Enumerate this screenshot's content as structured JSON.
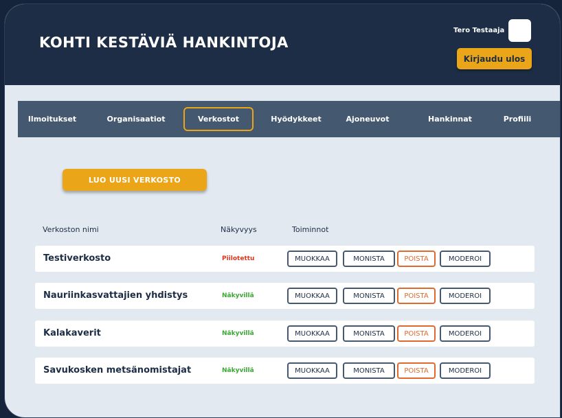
{
  "header": {
    "title": "KOHTI KESTÄVIÄ HANKINTOJA",
    "user_name": "Tero Testaaja",
    "logout_label": "Kirjaudu ulos"
  },
  "nav": {
    "items": [
      "Ilmoitukset",
      "Organisaatiot",
      "Verkostot",
      "Hyödykkeet",
      "Ajoneuvot",
      "Hankinnat",
      "Profiili"
    ],
    "active": "Verkostot"
  },
  "create_button_label": "LUO UUSI VERKOSTO",
  "table": {
    "columns": [
      "Verkoston nimi",
      "Näkyvyys",
      "Toiminnot"
    ],
    "action_labels": [
      "MUOKKAA",
      "MONISTA",
      "POISTA",
      "MODEROI"
    ],
    "rows": [
      {
        "name": "Testiverkosto",
        "visibility": "Piilotettu",
        "visibility_color": "#e0361c"
      },
      {
        "name": "Nauriinkasvattajien yhdistys",
        "visibility": "Näkyvillä",
        "visibility_color": "#3aa832"
      },
      {
        "name": "Kalakaverit",
        "visibility": "Näkyvillä",
        "visibility_color": "#3aa832"
      },
      {
        "name": "Savukosken metsänomistajat",
        "visibility": "Näkyvillä",
        "visibility_color": "#3aa832"
      }
    ]
  },
  "colors": {
    "header_bg": "#1c2d45",
    "accent": "#eba518",
    "nav_bg": "#44586f",
    "danger": "#e06a2e"
  }
}
